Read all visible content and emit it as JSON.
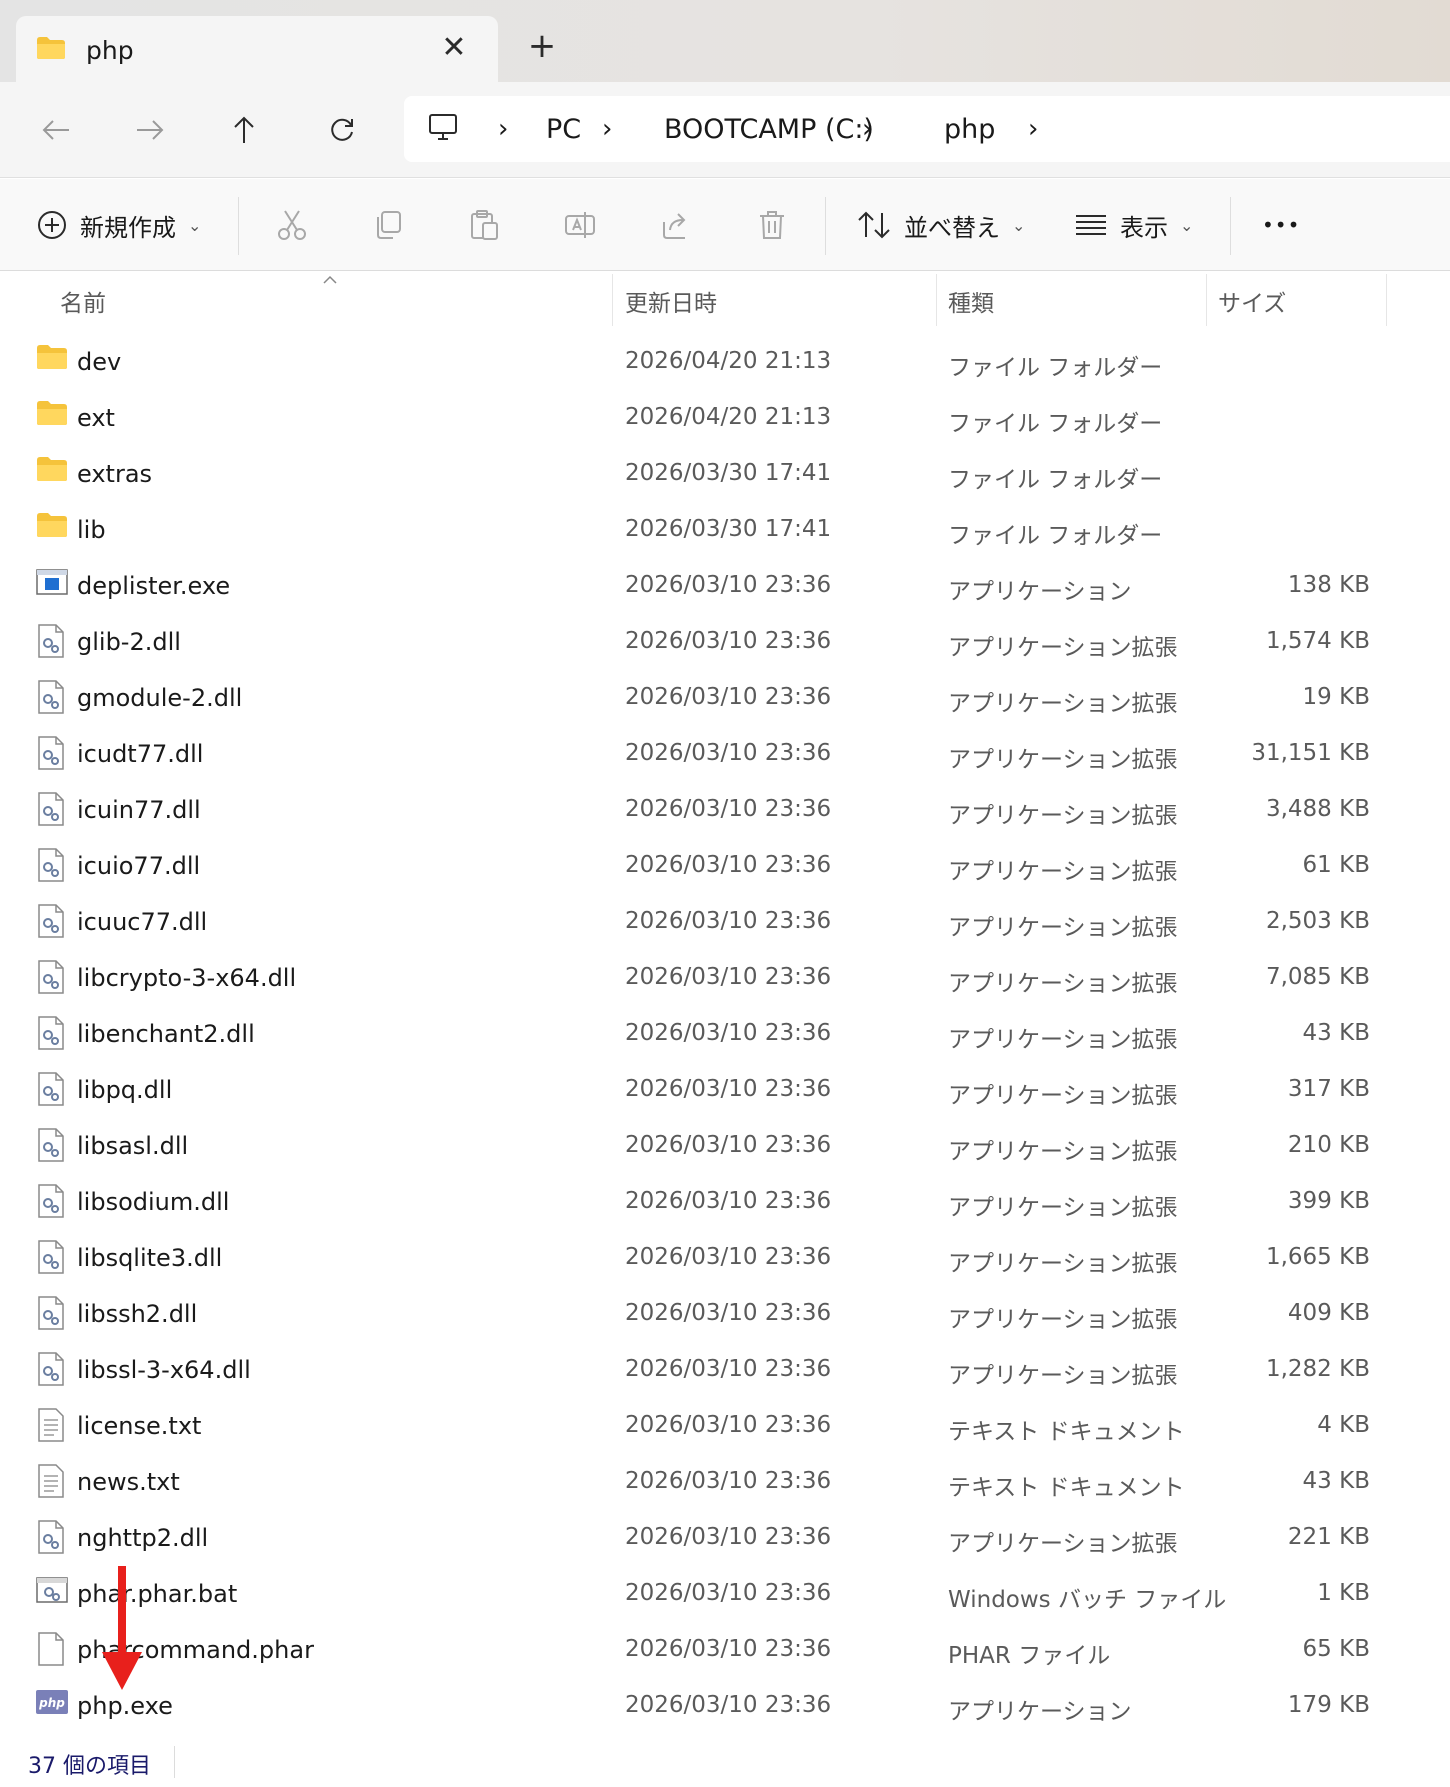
{
  "window": {
    "tab_title": "php",
    "close_glyph": "✕",
    "new_tab_glyph": "+"
  },
  "nav": {
    "breadcrumbs": [
      "PC",
      "BOOTCAMP (C:)",
      "php"
    ],
    "separator": "›"
  },
  "toolbar": {
    "new_label": "新規作成",
    "sort_label": "並べ替え",
    "view_label": "表示",
    "more_label": "•••",
    "chevron": "⌄"
  },
  "columns": {
    "name": "名前",
    "date": "更新日時",
    "type": "種類",
    "size": "サイズ"
  },
  "files": [
    {
      "name": "dev",
      "date": "2026/04/20 21:13",
      "type": "ファイル フォルダー",
      "size": "",
      "icon": "folder-icon"
    },
    {
      "name": "ext",
      "date": "2026/04/20 21:13",
      "type": "ファイル フォルダー",
      "size": "",
      "icon": "folder-icon"
    },
    {
      "name": "extras",
      "date": "2026/03/30 17:41",
      "type": "ファイル フォルダー",
      "size": "",
      "icon": "folder-icon"
    },
    {
      "name": "lib",
      "date": "2026/03/30 17:41",
      "type": "ファイル フォルダー",
      "size": "",
      "icon": "folder-icon"
    },
    {
      "name": "deplister.exe",
      "date": "2026/03/10 23:36",
      "type": "アプリケーション",
      "size": "138 KB",
      "icon": "exe-icon"
    },
    {
      "name": "glib-2.dll",
      "date": "2026/03/10 23:36",
      "type": "アプリケーション拡張",
      "size": "1,574 KB",
      "icon": "dll-icon"
    },
    {
      "name": "gmodule-2.dll",
      "date": "2026/03/10 23:36",
      "type": "アプリケーション拡張",
      "size": "19 KB",
      "icon": "dll-icon"
    },
    {
      "name": "icudt77.dll",
      "date": "2026/03/10 23:36",
      "type": "アプリケーション拡張",
      "size": "31,151 KB",
      "icon": "dll-icon"
    },
    {
      "name": "icuin77.dll",
      "date": "2026/03/10 23:36",
      "type": "アプリケーション拡張",
      "size": "3,488 KB",
      "icon": "dll-icon"
    },
    {
      "name": "icuio77.dll",
      "date": "2026/03/10 23:36",
      "type": "アプリケーション拡張",
      "size": "61 KB",
      "icon": "dll-icon"
    },
    {
      "name": "icuuc77.dll",
      "date": "2026/03/10 23:36",
      "type": "アプリケーション拡張",
      "size": "2,503 KB",
      "icon": "dll-icon"
    },
    {
      "name": "libcrypto-3-x64.dll",
      "date": "2026/03/10 23:36",
      "type": "アプリケーション拡張",
      "size": "7,085 KB",
      "icon": "dll-icon"
    },
    {
      "name": "libenchant2.dll",
      "date": "2026/03/10 23:36",
      "type": "アプリケーション拡張",
      "size": "43 KB",
      "icon": "dll-icon"
    },
    {
      "name": "libpq.dll",
      "date": "2026/03/10 23:36",
      "type": "アプリケーション拡張",
      "size": "317 KB",
      "icon": "dll-icon"
    },
    {
      "name": "libsasl.dll",
      "date": "2026/03/10 23:36",
      "type": "アプリケーション拡張",
      "size": "210 KB",
      "icon": "dll-icon"
    },
    {
      "name": "libsodium.dll",
      "date": "2026/03/10 23:36",
      "type": "アプリケーション拡張",
      "size": "399 KB",
      "icon": "dll-icon"
    },
    {
      "name": "libsqlite3.dll",
      "date": "2026/03/10 23:36",
      "type": "アプリケーション拡張",
      "size": "1,665 KB",
      "icon": "dll-icon"
    },
    {
      "name": "libssh2.dll",
      "date": "2026/03/10 23:36",
      "type": "アプリケーション拡張",
      "size": "409 KB",
      "icon": "dll-icon"
    },
    {
      "name": "libssl-3-x64.dll",
      "date": "2026/03/10 23:36",
      "type": "アプリケーション拡張",
      "size": "1,282 KB",
      "icon": "dll-icon"
    },
    {
      "name": "license.txt",
      "date": "2026/03/10 23:36",
      "type": "テキスト ドキュメント",
      "size": "4 KB",
      "icon": "text-file-icon"
    },
    {
      "name": "news.txt",
      "date": "2026/03/10 23:36",
      "type": "テキスト ドキュメント",
      "size": "43 KB",
      "icon": "text-file-icon"
    },
    {
      "name": "nghttp2.dll",
      "date": "2026/03/10 23:36",
      "type": "アプリケーション拡張",
      "size": "221 KB",
      "icon": "dll-icon"
    },
    {
      "name": "phar.phar.bat",
      "date": "2026/03/10 23:36",
      "type": "Windows バッチ ファイル",
      "size": "1 KB",
      "icon": "batch-file-icon"
    },
    {
      "name": "pharcommand.phar",
      "date": "2026/03/10 23:36",
      "type": "PHAR ファイル",
      "size": "65 KB",
      "icon": "blank-file-icon"
    },
    {
      "name": "php.exe",
      "date": "2026/03/10 23:36",
      "type": "アプリケーション",
      "size": "179 KB",
      "icon": "php-icon"
    }
  ],
  "php_icon_text": "php",
  "status": {
    "item_count": "37 個の項目"
  },
  "colors": {
    "folder": "#f5c33b",
    "annotation_arrow": "#e8201c",
    "php_badge": "#7a80b8"
  }
}
